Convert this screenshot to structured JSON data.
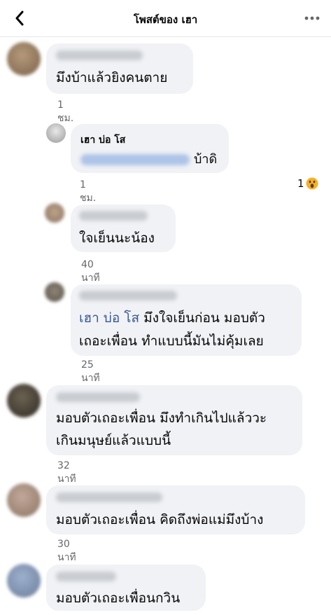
{
  "header": {
    "title": "โพสต์ของ เฮา",
    "back_icon": "chevron-left-icon",
    "more_icon": "more-horizontal-icon"
  },
  "comments": [
    {
      "lines": [
        "มึงบ้าแล้วยิงคนตาย"
      ],
      "time": "1 ชม."
    },
    {
      "author": "เฮา บ่อ โส",
      "lines": [
        "บ้าดิ"
      ],
      "time": "1 ชม.",
      "reaction_icon": "wow-reaction-icon",
      "reaction_count": "1"
    },
    {
      "lines": [
        "ใจเย็นนะน้อง"
      ],
      "time": "40 นาที"
    },
    {
      "mention": "เฮา บ่อ โส",
      "lines": [
        " มึงใจเย็นก่อน มอบตัว",
        "เถอะเพื่อน ทำแบบนี้มันไม่คุ้มเลย"
      ],
      "time": "25 นาที"
    },
    {
      "lines": [
        "มอบตัวเถอะเพื่อน มึงทำเกินไปแล้ววะ",
        "เกินมนุษย์แล้วแบบนี้"
      ],
      "time": "32 นาที"
    },
    {
      "lines": [
        "มอบตัวเถอะเพื่อน คิดถึงพ่อแม่มึงบ้าง"
      ],
      "time": "30 นาที"
    },
    {
      "lines": [
        "มอบตัวเถอะเพื่อนกวิน"
      ]
    }
  ]
}
